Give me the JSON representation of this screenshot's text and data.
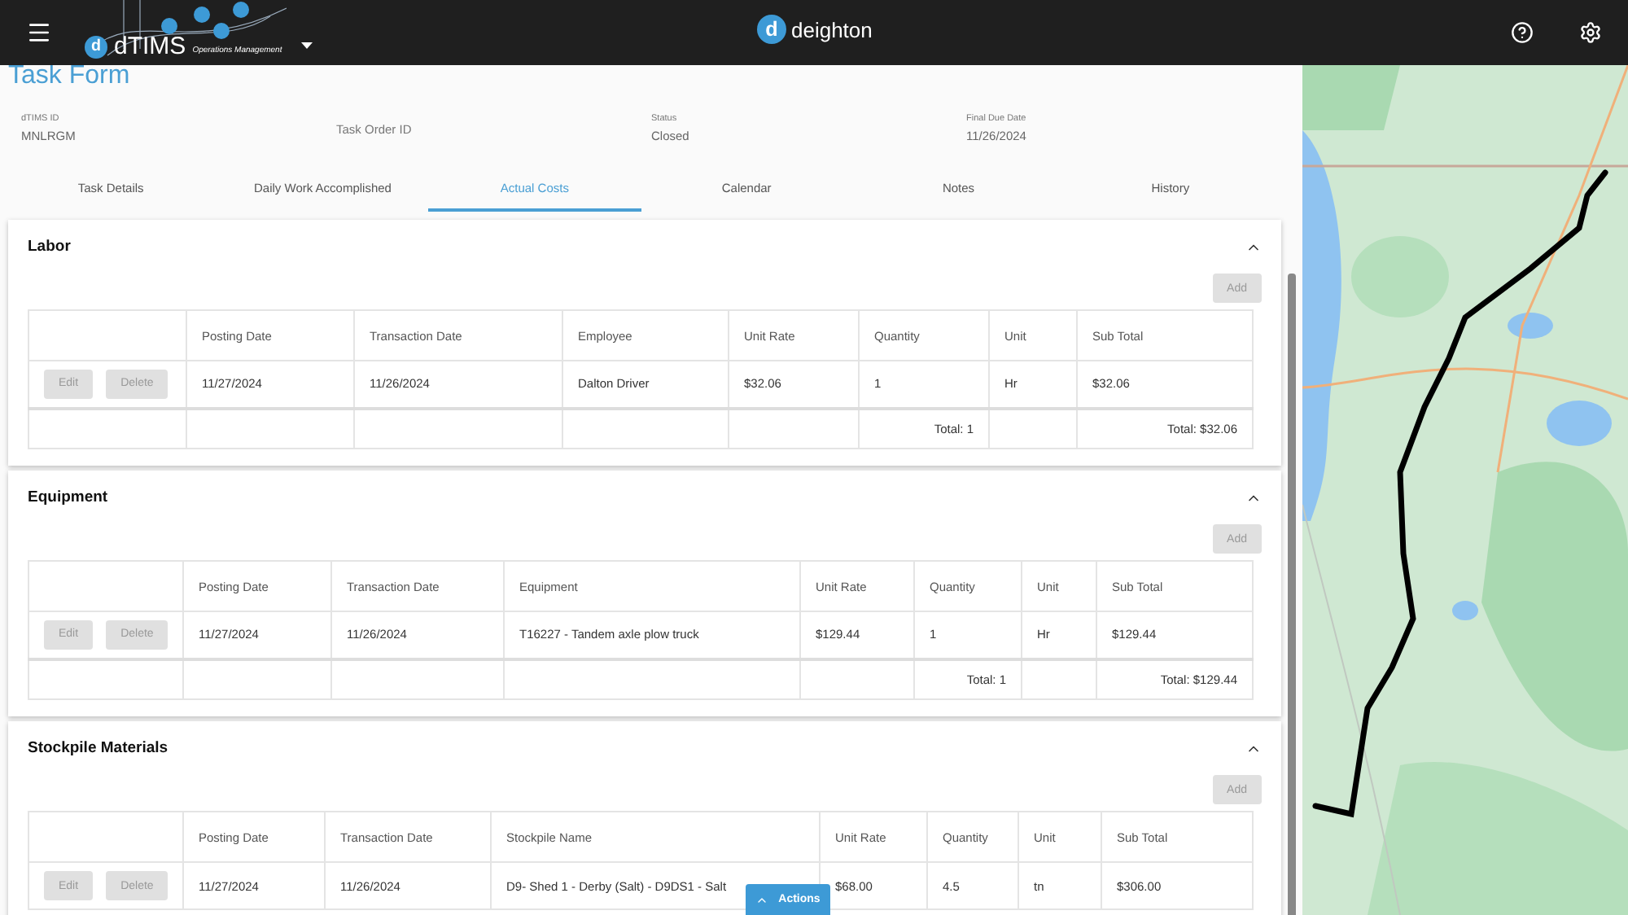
{
  "header": {
    "app_logo": {
      "mark": "d",
      "name": "dTIMS",
      "subtitle": "Operations Management"
    },
    "brand": {
      "mark": "d",
      "name": "deighton"
    }
  },
  "page_title": "Task Form",
  "fields": [
    {
      "label": "dTIMS ID",
      "value": "MNLRGM"
    },
    {
      "label": "Task Order ID"
    },
    {
      "label": "Status",
      "value": "Closed"
    },
    {
      "label": "Final Due Date",
      "value": "11/26/2024"
    }
  ],
  "tabs": [
    {
      "label": "Task Details",
      "selected": false
    },
    {
      "label": "Daily Work Accomplished",
      "selected": false
    },
    {
      "label": "Actual Costs",
      "selected": true
    },
    {
      "label": "Calendar",
      "selected": false
    },
    {
      "label": "Notes",
      "selected": false
    },
    {
      "label": "History",
      "selected": false
    }
  ],
  "sections": [
    {
      "title": "Labor",
      "expanded": true,
      "add_button": {
        "label": "Add",
        "disabled": true
      },
      "columns": [
        "Posting Date",
        "Transaction Date",
        "Employee",
        "Unit Rate",
        "Quantity",
        "Unit",
        "Sub Total"
      ],
      "rows": [
        {
          "actions": [
            {
              "label": "Edit",
              "disabled": true
            },
            {
              "label": "Delete",
              "disabled": true
            }
          ],
          "cells": [
            "11/27/2024",
            "11/26/2024",
            "Dalton Driver",
            "$32.06",
            "1",
            "Hr",
            "$32.06"
          ]
        }
      ],
      "totals": {
        "quantity": "Total: 1",
        "sub_total": "Total: $32.06"
      }
    },
    {
      "title": "Equipment",
      "expanded": true,
      "add_button": {
        "label": "Add",
        "disabled": true
      },
      "columns": [
        "Posting Date",
        "Transaction Date",
        "Equipment",
        "Unit Rate",
        "Quantity",
        "Unit",
        "Sub Total"
      ],
      "rows": [
        {
          "actions": [
            {
              "label": "Edit",
              "disabled": true
            },
            {
              "label": "Delete",
              "disabled": true
            }
          ],
          "cells": [
            "11/27/2024",
            "11/26/2024",
            "T16227 - Tandem axle plow truck",
            "$129.44",
            "1",
            "Hr",
            "$129.44"
          ]
        }
      ],
      "totals": {
        "quantity": "Total: 1",
        "sub_total": "Total: $129.44"
      }
    },
    {
      "title": "Stockpile Materials",
      "expanded": true,
      "add_button": {
        "label": "Add",
        "disabled": true
      },
      "columns": [
        "Posting Date",
        "Transaction Date",
        "Stockpile Name",
        "Unit Rate",
        "Quantity",
        "Unit",
        "Sub Total"
      ],
      "rows": [
        {
          "actions": [
            {
              "label": "Edit",
              "disabled": true
            },
            {
              "label": "Delete",
              "disabled": true
            }
          ],
          "cells": [
            "11/27/2024",
            "11/26/2024",
            "D9- Shed 1 - Derby (Salt) - D9DS1 - Salt",
            "$68.00",
            "4.5",
            "tn",
            "$306.00"
          ]
        }
      ]
    }
  ],
  "actions_button": {
    "label": "Actions"
  }
}
